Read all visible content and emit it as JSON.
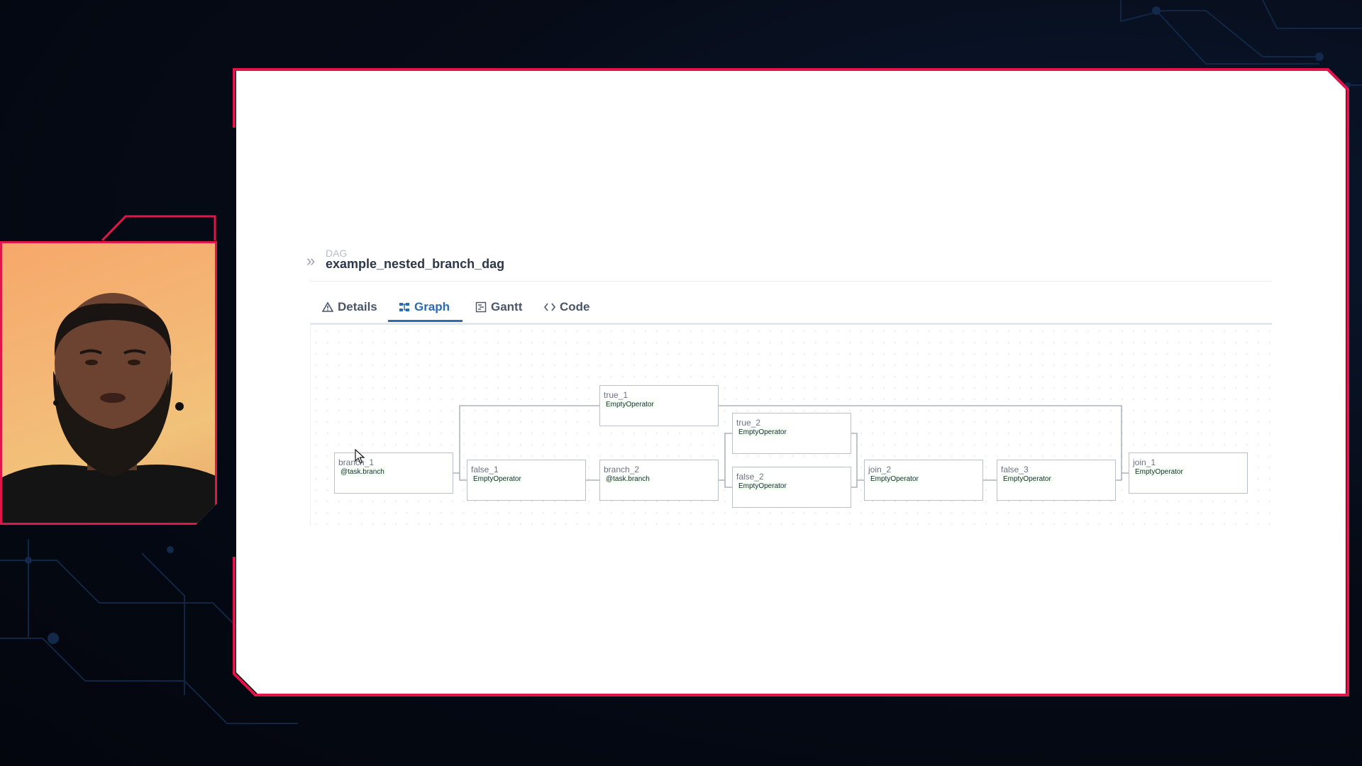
{
  "dag": {
    "label": "DAG",
    "title": "example_nested_branch_dag"
  },
  "tabs": [
    {
      "label": "Details",
      "icon": "warning-triangle-icon",
      "active": false
    },
    {
      "label": "Graph",
      "icon": "graph-icon",
      "active": true
    },
    {
      "label": "Gantt",
      "icon": "gantt-icon",
      "active": false
    },
    {
      "label": "Code",
      "icon": "code-icon",
      "active": false
    }
  ],
  "nodes": {
    "branch_1": {
      "id": "branch_1",
      "operator": "@task.branch"
    },
    "false_1": {
      "id": "false_1",
      "operator": "EmptyOperator"
    },
    "true_1": {
      "id": "true_1",
      "operator": "EmptyOperator"
    },
    "branch_2": {
      "id": "branch_2",
      "operator": "@task.branch"
    },
    "true_2": {
      "id": "true_2",
      "operator": "EmptyOperator"
    },
    "false_2": {
      "id": "false_2",
      "operator": "EmptyOperator"
    },
    "join_2": {
      "id": "join_2",
      "operator": "EmptyOperator"
    },
    "false_3": {
      "id": "false_3",
      "operator": "EmptyOperator"
    },
    "join_1": {
      "id": "join_1",
      "operator": "EmptyOperator"
    }
  },
  "colors": {
    "accent_frame": "#e0164b",
    "active_tab": "#2b6cb0",
    "node_border": "#b9c0c8",
    "operator_highlight": "#f0fff0"
  }
}
